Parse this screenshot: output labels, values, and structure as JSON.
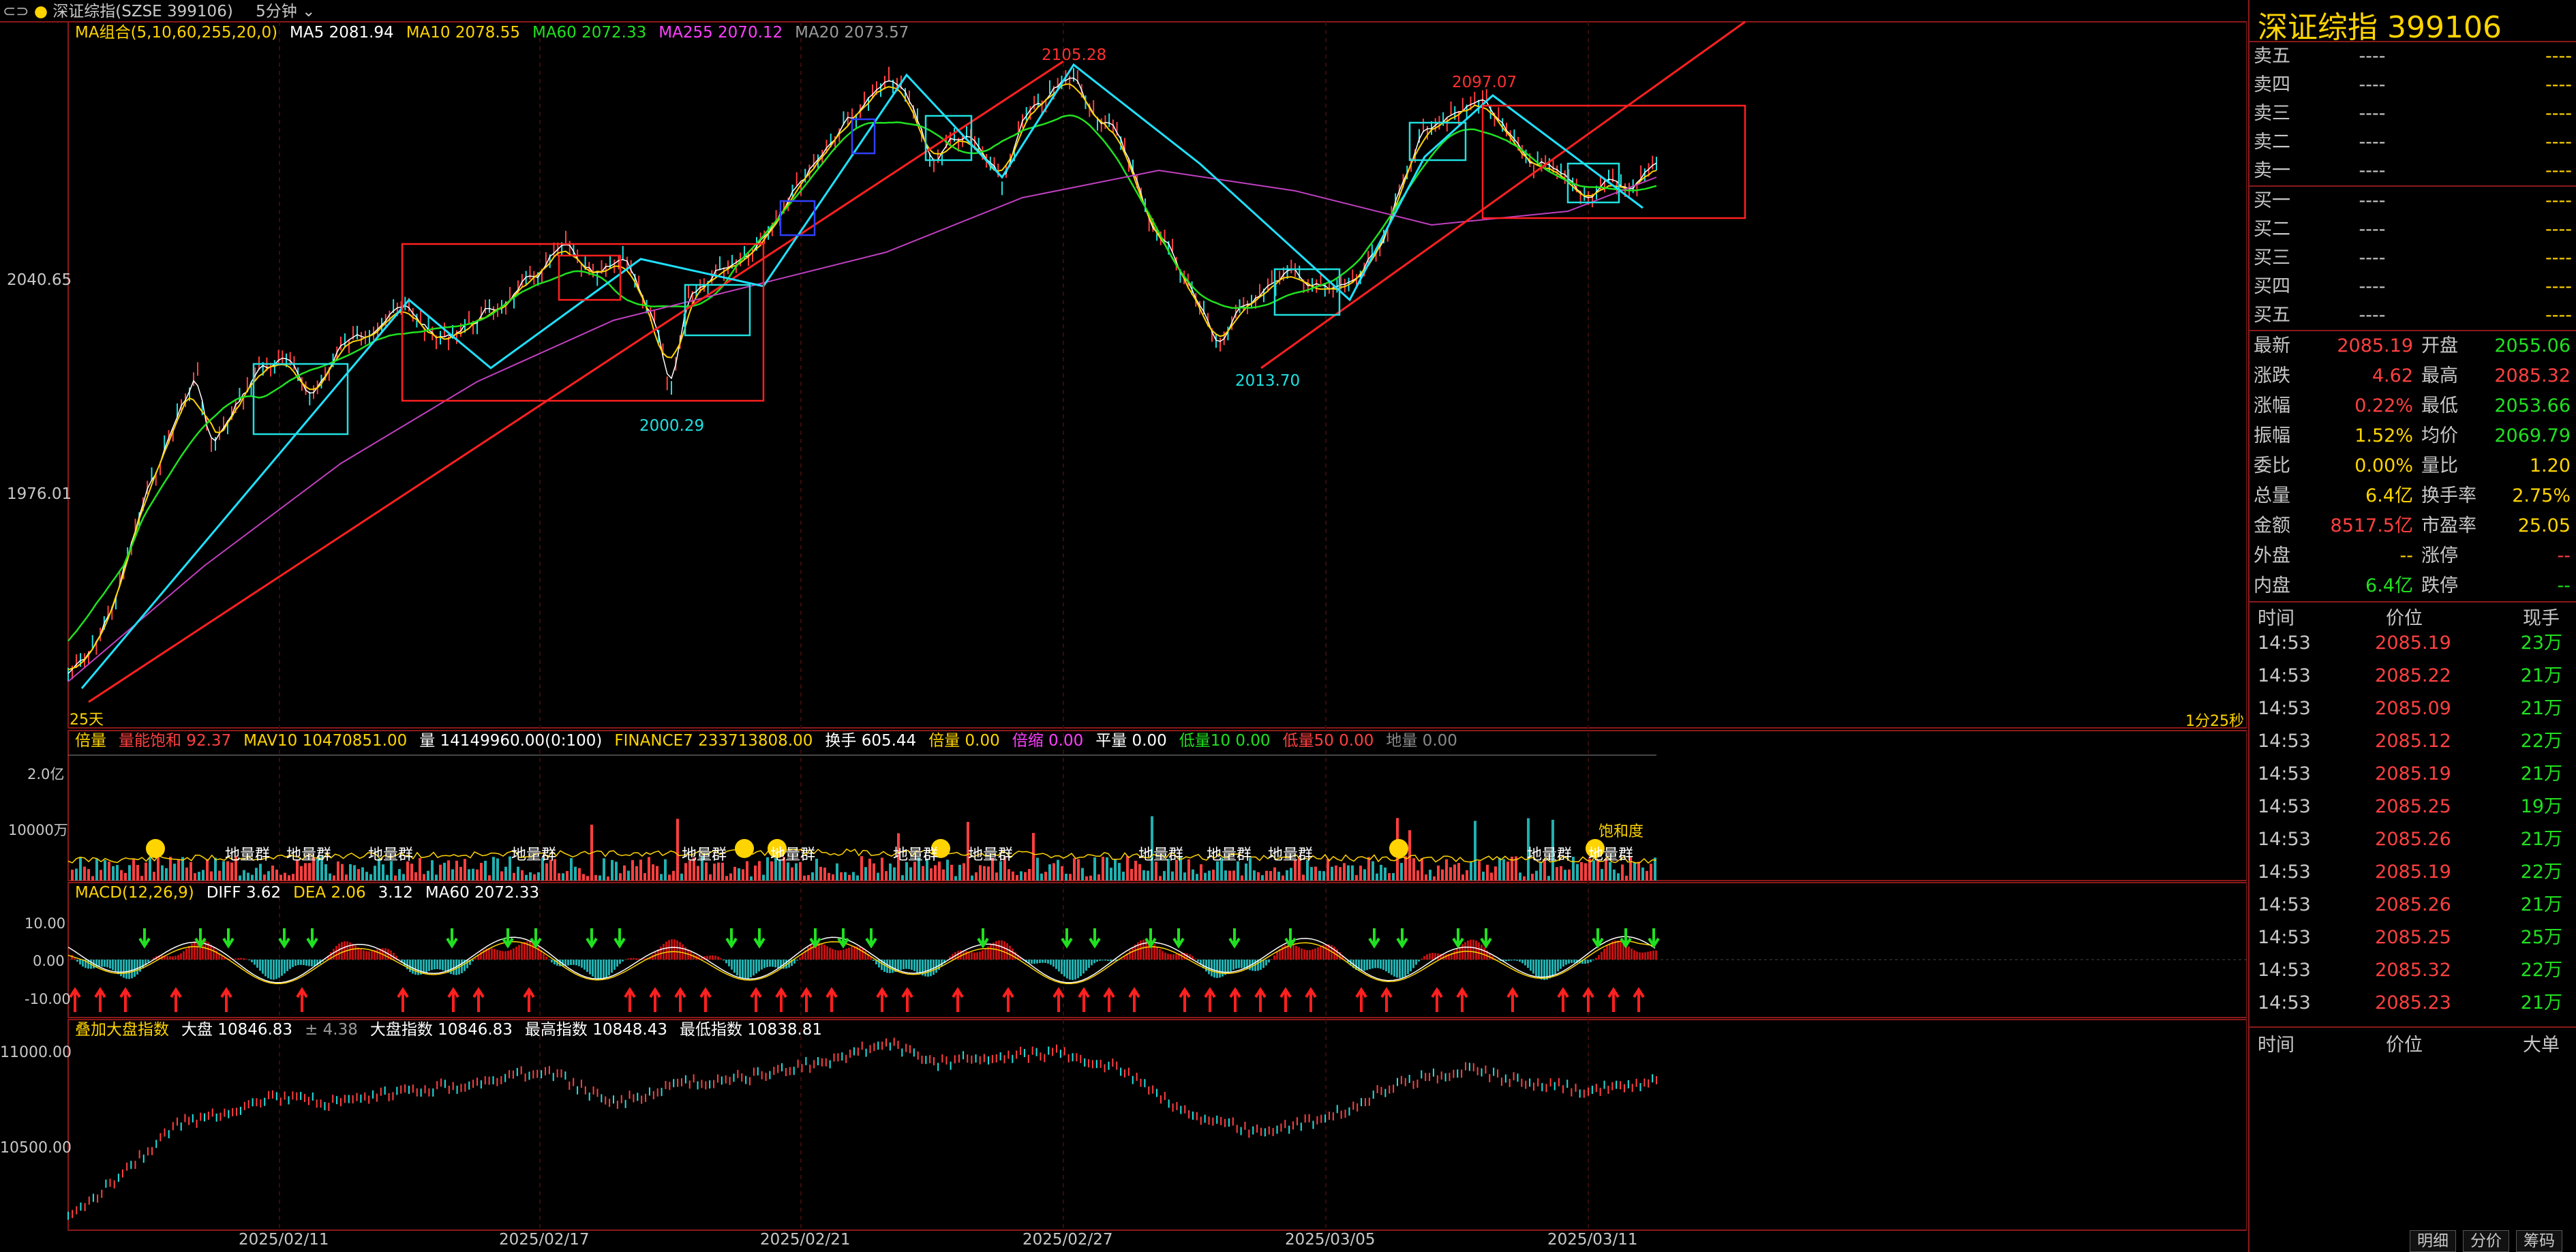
{
  "header": {
    "title": "深证综指(SZSE  399106)",
    "period": "5分钟"
  },
  "main_legend": [
    {
      "label": "MA组合(5,10,60,255,20,0)",
      "color": "#ffd400"
    },
    {
      "label": "MA5  2081.94",
      "color": "#ffffff"
    },
    {
      "label": "MA10  2078.55",
      "color": "#ffd400"
    },
    {
      "label": "MA60  2072.33",
      "color": "#20e020"
    },
    {
      "label": "MA255  2070.12",
      "color": "#ff40ff"
    },
    {
      "label": "MA20  2073.57",
      "color": "#9a9a9a"
    }
  ],
  "price_axis": {
    "a": "2040.65",
    "b": "1976.01"
  },
  "annotations": {
    "high1": "2105.28",
    "high2": "2097.07",
    "low1": "2000.29",
    "low2": "2013.70",
    "days": "25天",
    "countdown": "1分25秒"
  },
  "vol_legend": [
    {
      "label": "倍量",
      "color": "#ffd400"
    },
    {
      "label": "量能饱和  92.37",
      "color": "#ff4040"
    },
    {
      "label": "MAV10  10470851.00",
      "color": "#ffd400"
    },
    {
      "label": "量  14149960.00(0:100)",
      "color": "#ffffff"
    },
    {
      "label": "FINANCE7  233713808.00",
      "color": "#ffd400"
    },
    {
      "label": "换手  605.44",
      "color": "#ffffff"
    },
    {
      "label": "倍量  0.00",
      "color": "#ffd400"
    },
    {
      "label": "倍缩  0.00",
      "color": "#ff40ff"
    },
    {
      "label": "平量  0.00",
      "color": "#ffffff"
    },
    {
      "label": "低量10  0.00",
      "color": "#20e020"
    },
    {
      "label": "低量50  0.00",
      "color": "#ff4040"
    },
    {
      "label": "地量  0.00",
      "color": "#888888"
    }
  ],
  "vol_axis": {
    "a": "2.0亿",
    "b": "10000万"
  },
  "vol_tags": {
    "dlq": "地量群",
    "bhd": "饱和度"
  },
  "macd_legend": [
    {
      "label": "MACD(12,26,9)",
      "color": "#ffd400"
    },
    {
      "label": "DIFF  3.62",
      "color": "#ffffff"
    },
    {
      "label": "DEA  2.06",
      "color": "#ffd400"
    },
    {
      "label": "3.12",
      "color": "#ffffff"
    },
    {
      "label": "MA60  2072.33",
      "color": "#ffffff"
    }
  ],
  "macd_axis": {
    "a": "10.00",
    "b": "0.00",
    "c": "-10.00"
  },
  "idx_legend": [
    {
      "label": "叠加大盘指数",
      "color": "#ffd400"
    },
    {
      "label": "大盘  10846.83",
      "color": "#ffffff"
    },
    {
      "label": "± 4.38",
      "color": "#9a9a9a"
    },
    {
      "label": "大盘指数  10846.83",
      "color": "#ffffff"
    },
    {
      "label": "最高指数  10848.43",
      "color": "#ffffff"
    },
    {
      "label": "最低指数  10838.81",
      "color": "#ffffff"
    }
  ],
  "idx_axis": {
    "a": "11000.00",
    "b": "10500.00"
  },
  "dates": [
    "2025/02/11",
    "2025/02/17",
    "2025/02/21",
    "2025/02/27",
    "2025/03/05",
    "2025/03/11"
  ],
  "right": {
    "title": "深证综指  399106",
    "asks": [
      {
        "label": "卖五",
        "price": "----",
        "vol": "----"
      },
      {
        "label": "卖四",
        "price": "----",
        "vol": "----"
      },
      {
        "label": "卖三",
        "price": "----",
        "vol": "----"
      },
      {
        "label": "卖二",
        "price": "----",
        "vol": "----"
      },
      {
        "label": "卖一",
        "price": "----",
        "vol": "----"
      }
    ],
    "bids": [
      {
        "label": "买一",
        "price": "----",
        "vol": "----"
      },
      {
        "label": "买二",
        "price": "----",
        "vol": "----"
      },
      {
        "label": "买三",
        "price": "----",
        "vol": "----"
      },
      {
        "label": "买四",
        "price": "----",
        "vol": "----"
      },
      {
        "label": "买五",
        "price": "----",
        "vol": "----"
      }
    ],
    "quotes": [
      {
        "l1": "最新",
        "v1": "2085.19",
        "c1": "red",
        "l2": "开盘",
        "v2": "2055.06",
        "c2": "green"
      },
      {
        "l1": "涨跌",
        "v1": "4.62",
        "c1": "red",
        "l2": "最高",
        "v2": "2085.32",
        "c2": "red"
      },
      {
        "l1": "涨幅",
        "v1": "0.22%",
        "c1": "red",
        "l2": "最低",
        "v2": "2053.66",
        "c2": "green"
      },
      {
        "l1": "振幅",
        "v1": "1.52%",
        "c1": "yellow",
        "l2": "均价",
        "v2": "2069.79",
        "c2": "green"
      },
      {
        "l1": "委比",
        "v1": "0.00%",
        "c1": "yellow",
        "l2": "量比",
        "v2": "1.20",
        "c2": "yellow"
      },
      {
        "l1": "总量",
        "v1": "6.4亿",
        "c1": "yellow",
        "l2": "换手率",
        "v2": "2.75%",
        "c2": "yellow"
      },
      {
        "l1": "金额",
        "v1": "8517.5亿",
        "c1": "red",
        "l2": "市盈率",
        "v2": "25.05",
        "c2": "yellow"
      },
      {
        "l1": "外盘",
        "v1": "--",
        "c1": "yellow",
        "l2": "涨停",
        "v2": "--",
        "c2": "red"
      },
      {
        "l1": "内盘",
        "v1": "6.4亿",
        "c1": "green",
        "l2": "跌停",
        "v2": "--",
        "c2": "green"
      }
    ],
    "ticks_header": {
      "time": "时间",
      "price": "价位",
      "vol": "现手"
    },
    "ticks": [
      {
        "time": "14:53",
        "price": "2085.19",
        "vol": "23万"
      },
      {
        "time": "14:53",
        "price": "2085.22",
        "vol": "21万"
      },
      {
        "time": "14:53",
        "price": "2085.09",
        "vol": "21万"
      },
      {
        "time": "14:53",
        "price": "2085.12",
        "vol": "22万"
      },
      {
        "time": "14:53",
        "price": "2085.19",
        "vol": "21万"
      },
      {
        "time": "14:53",
        "price": "2085.25",
        "vol": "19万"
      },
      {
        "time": "14:53",
        "price": "2085.26",
        "vol": "21万"
      },
      {
        "time": "14:53",
        "price": "2085.19",
        "vol": "22万"
      },
      {
        "time": "14:53",
        "price": "2085.26",
        "vol": "21万"
      },
      {
        "time": "14:53",
        "price": "2085.25",
        "vol": "25万"
      },
      {
        "time": "14:53",
        "price": "2085.32",
        "vol": "22万"
      },
      {
        "time": "14:53",
        "price": "2085.23",
        "vol": "21万"
      }
    ],
    "big_header": {
      "time": "时间",
      "price": "价位",
      "vol": "大单"
    },
    "tabs": [
      "明细",
      "分价",
      "筹码"
    ]
  },
  "colors": {
    "up": "#ff4040",
    "down": "#20e0e0",
    "ma5": "#ffffff",
    "ma10": "#ffd400",
    "ma60": "#20e020",
    "ma255": "#c040c0",
    "frame": "#8a1a1a"
  }
}
